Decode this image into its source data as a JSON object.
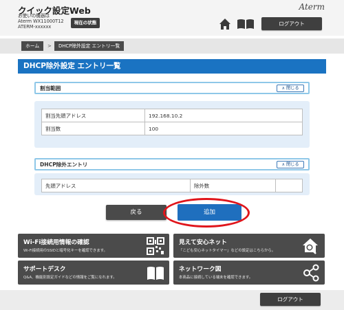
{
  "header": {
    "app_title": "クイック設定Web",
    "device_line1": "お使いの機器は",
    "device_line2": "Aterm WX11000T12",
    "device_line3": "ATERM-xxxxxx",
    "status_button": "現在の状態",
    "brand": "Aterm",
    "logout": "ログアウト"
  },
  "breadcrumb": {
    "home": "ホーム",
    "separator": ">",
    "current": "DHCP除外設定 エントリ一覧"
  },
  "page_title": "DHCP除外設定 エントリ一覧",
  "allocation": {
    "header": "割当範囲",
    "close_label": "閉じる",
    "rows": [
      {
        "label": "割当先頭アドレス",
        "value": "192.168.10.2"
      },
      {
        "label": "割当数",
        "value": "100"
      }
    ]
  },
  "exclusion": {
    "header": "DHCP除外エントリ",
    "close_label": "閉じる",
    "col_start": "先頭アドレス",
    "col_count": "除外数",
    "col_extra": ""
  },
  "actions": {
    "back": "戻る",
    "add": "追加"
  },
  "cards": [
    {
      "title": "Wi-Fi接続用情報の確認",
      "subtitle": "Wi-Fi接続用のSSIDと暗号化キーを確認できます。",
      "icon": "qr-code-icon"
    },
    {
      "title": "見えて安心ネット",
      "subtitle": "「こども安心ネットタイマー」などの設定はこちらから。",
      "icon": "house-search-icon"
    },
    {
      "title": "サポートデスク",
      "subtitle": "Q&A、機能別設定ガイドなどの情報をご覧になれます。",
      "icon": "book-icon"
    },
    {
      "title": "ネットワーク図",
      "subtitle": "本商品に接続している端末を確認できます。",
      "icon": "network-icon"
    }
  ],
  "footer": {
    "logout": "ログアウト"
  },
  "colors": {
    "accent_blue": "#1a73c2",
    "highlight_red": "#e0151b",
    "dark_button": "#4a4a4a"
  }
}
